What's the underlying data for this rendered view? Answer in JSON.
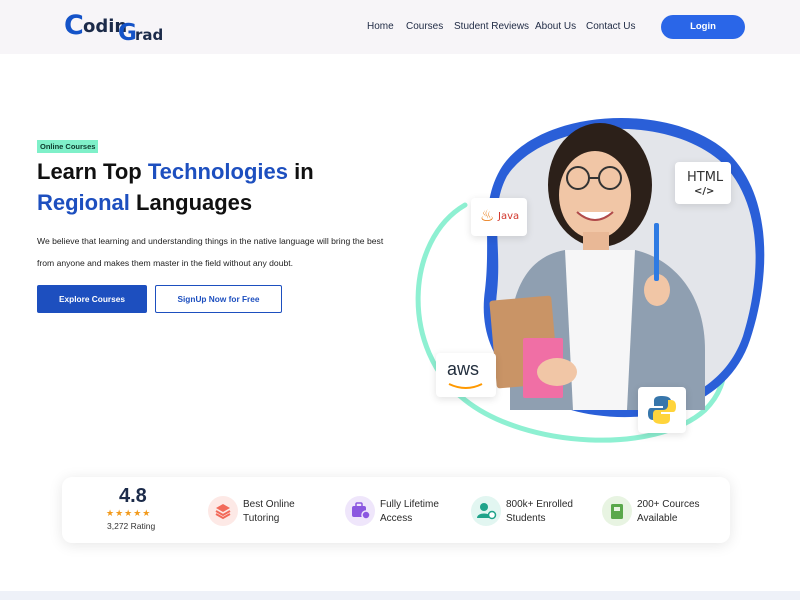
{
  "header": {
    "logo_c": "C",
    "logo_odin": "odin",
    "logo_g": "G",
    "logo_rad": "rad",
    "nav": [
      "Home",
      "Courses",
      "Student Reviews",
      "About Us",
      "Contact Us"
    ],
    "login_label": "Login"
  },
  "hero": {
    "badge": "Online Courses",
    "title_part1": "Learn Top ",
    "title_highlight1": "Technologies",
    "title_part2": " in",
    "title_highlight2": "Regional",
    "title_part3": " Languages",
    "description": "We believe that learning and understanding things in the native language will bring the best from anyone and makes them master in the field without any doubt.",
    "primary_button": "Explore Courses",
    "secondary_button": "SignUp Now for Free"
  },
  "art": {
    "html_label": "HTML",
    "html_code": "</>",
    "java_label": "Java",
    "aws_label": "aws"
  },
  "stats": {
    "rating_value": "4.8",
    "stars": "★★★★★",
    "rating_label": "3,272 Rating",
    "features": [
      {
        "line1": "Best Online",
        "line2": "Tutoring",
        "icon": "layers-icon",
        "color": "#f26a5a",
        "bg": "#fde9e6"
      },
      {
        "line1": "Fully Lifetime",
        "line2": "Access",
        "icon": "access-card-icon",
        "color": "#8b57e0",
        "bg": "#efe6fb"
      },
      {
        "line1": "800k+ Enrolled",
        "line2": "Students",
        "icon": "student-icon",
        "color": "#1fa38a",
        "bg": "#e2f6f1"
      },
      {
        "line1": "200+ Cources",
        "line2": "Available",
        "icon": "book-icon",
        "color": "#5aa84b",
        "bg": "#e8f4e2"
      }
    ]
  }
}
